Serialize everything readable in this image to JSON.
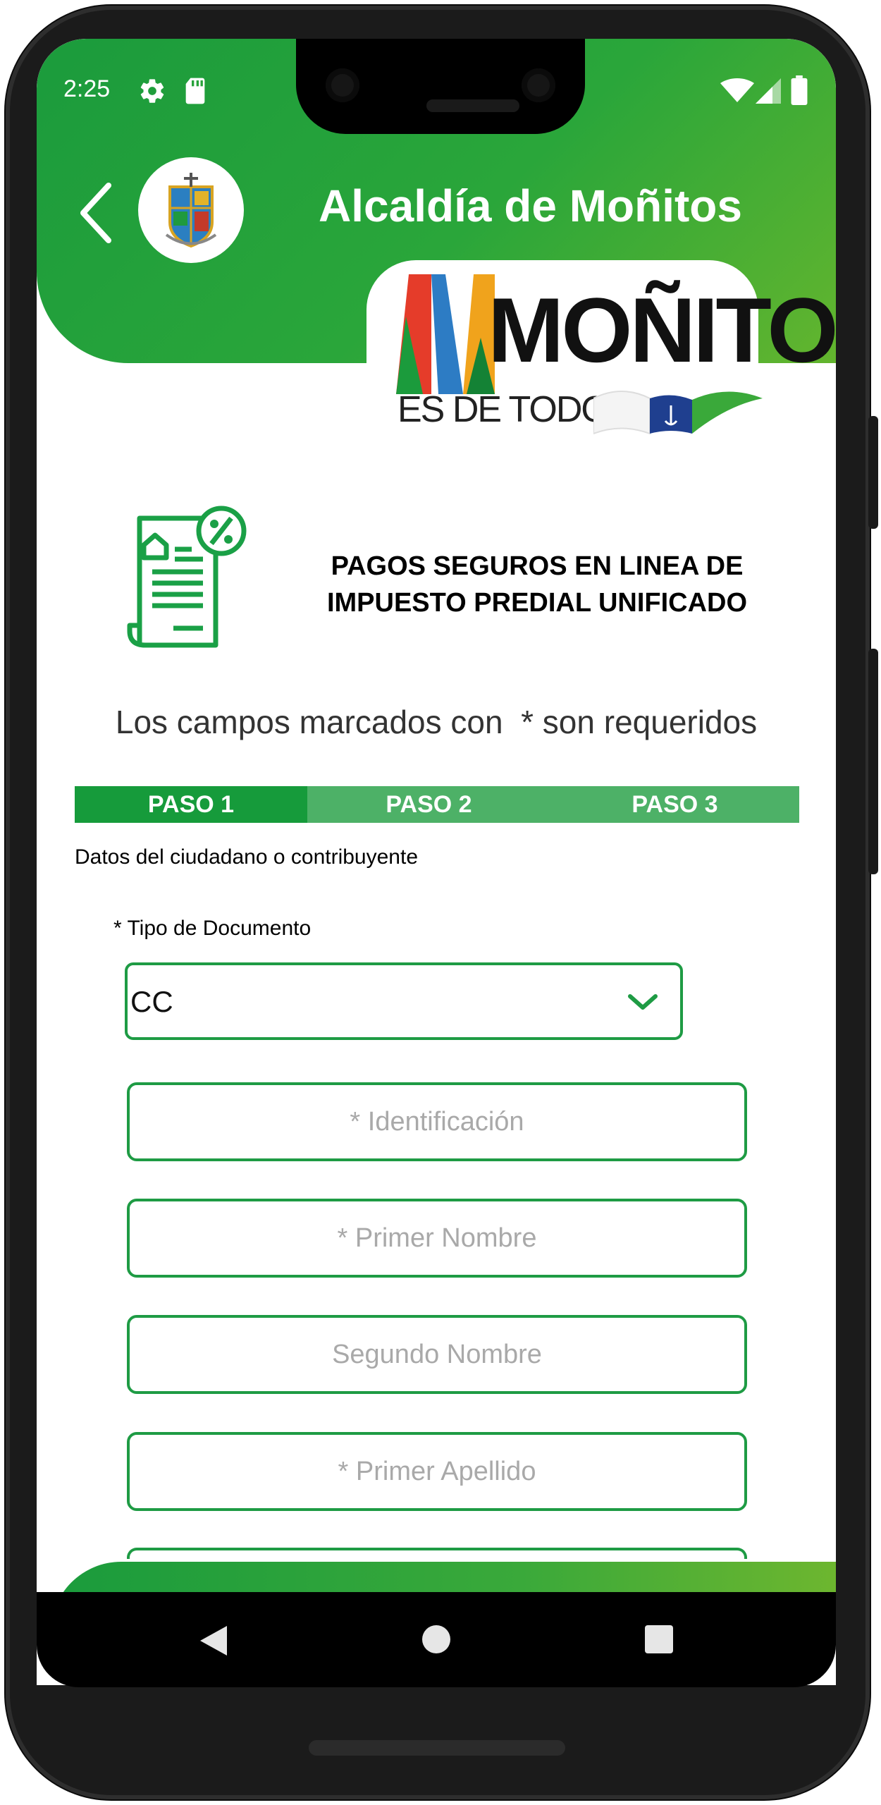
{
  "status_bar": {
    "time": "2:25",
    "icons": [
      "settings-icon",
      "sd-card-icon",
      "wifi-icon",
      "signal-icon",
      "battery-icon"
    ]
  },
  "header": {
    "title": "Alcaldía de Moñitos",
    "back_icon": "back-arrow-icon",
    "crest_icon": "municipal-crest-icon"
  },
  "logo": {
    "word": "MOÑITOS",
    "subtitle": "ES DE TODOS"
  },
  "intro": {
    "icon": "tax-receipt-icon",
    "headline_line1": "PAGOS SEGUROS EN LINEA DE",
    "headline_line2": "IMPUESTO PREDIAL UNIFICADO",
    "required_note": "Los campos marcados con  * son requeridos"
  },
  "steps": [
    {
      "label": "PASO 1",
      "active": true
    },
    {
      "label": "PASO 2",
      "active": false
    },
    {
      "label": "PASO 3",
      "active": false
    }
  ],
  "form": {
    "subtitle": "Datos del ciudadano o contribuyente",
    "doc_type_label": "* Tipo de Documento",
    "doc_type_value": "CC",
    "fields": {
      "identificacion": {
        "placeholder": "* Identificación",
        "value": ""
      },
      "primer_nombre": {
        "placeholder": "* Primer Nombre",
        "value": ""
      },
      "segundo_nombre": {
        "placeholder": "Segundo Nombre",
        "value": ""
      },
      "primer_apellido": {
        "placeholder": "* Primer Apellido",
        "value": ""
      }
    }
  },
  "nav_bar": {
    "icons": [
      "nav-back-icon",
      "nav-home-icon",
      "nav-recents-icon"
    ]
  },
  "colors": {
    "primary_green": "#1e9b44",
    "step_active": "#169b3b",
    "step_inactive": "#4db167",
    "header_gradient_end": "#63b52e"
  }
}
